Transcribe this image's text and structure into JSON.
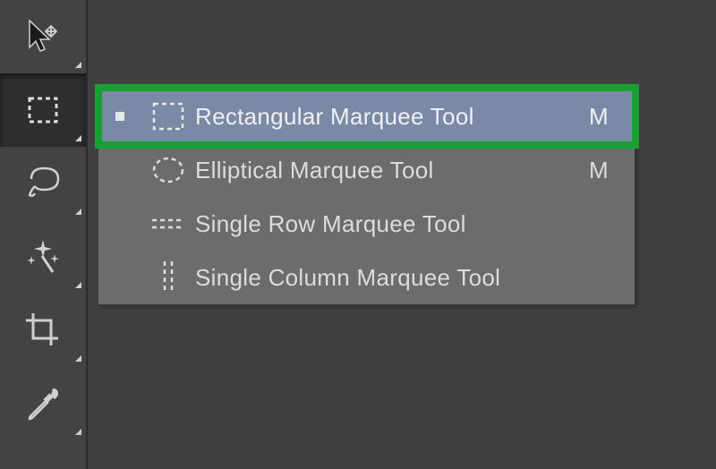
{
  "toolbar": {
    "tools": [
      {
        "name": "move"
      },
      {
        "name": "marquee"
      },
      {
        "name": "lasso"
      },
      {
        "name": "magic-wand"
      },
      {
        "name": "crop"
      },
      {
        "name": "eyedropper"
      }
    ]
  },
  "flyout": {
    "items": [
      {
        "label": "Rectangular Marquee Tool",
        "shortcut": "M",
        "active": true,
        "icon": "rect-marquee"
      },
      {
        "label": "Elliptical Marquee Tool",
        "shortcut": "M",
        "active": false,
        "icon": "ellipse-marquee"
      },
      {
        "label": "Single Row Marquee Tool",
        "shortcut": "",
        "active": false,
        "icon": "row-marquee"
      },
      {
        "label": "Single Column Marquee Tool",
        "shortcut": "",
        "active": false,
        "icon": "column-marquee"
      }
    ]
  },
  "colors": {
    "highlight": "#18a030",
    "flyout_bg": "#6c6c6c",
    "active_row": "#7a8aa6",
    "toolbar_bg": "#434343"
  }
}
